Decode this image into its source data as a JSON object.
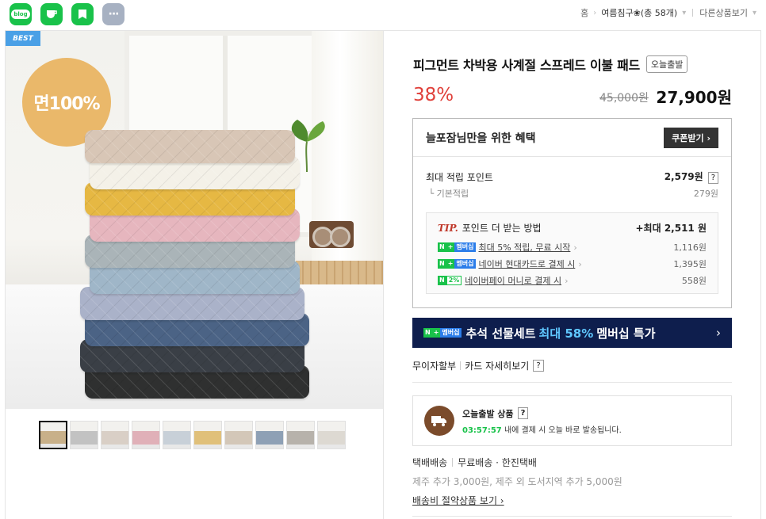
{
  "share": {
    "items": [
      {
        "name": "blog",
        "label": "blog"
      },
      {
        "name": "cafe",
        "label": ""
      },
      {
        "name": "band",
        "label": ""
      },
      {
        "name": "more",
        "label": "···"
      }
    ]
  },
  "breadcrumb": {
    "home": "홈",
    "current": "여름침구❀(총 58개)",
    "other": "다른상품보기"
  },
  "gallery": {
    "best_badge": "BEST",
    "cotton_label": "면100%",
    "thumb_count": 10
  },
  "product": {
    "title": "피그먼트 차박용 사계절 스프레드 이불 패드",
    "tag": "오늘출발",
    "discount": "38%",
    "original_price": "45,000원",
    "sale_price": "27,900원"
  },
  "benefit": {
    "title": "늘포잠님만을 위한 혜택",
    "coupon_button": "쿠폰받기 ›",
    "max_points_label": "최대 적립 포인트",
    "max_points_value": "2,579원",
    "base_label": "기본적립",
    "base_value": "279원",
    "tip_prefix": "TIP.",
    "tip_title": "포인트 더 받는 방법",
    "tip_total": "+최대 2,511 원",
    "tips": [
      {
        "badge": "N+멤버십",
        "text": "최대 5% 적립, 무료 시작",
        "value": "1,116원"
      },
      {
        "badge": "N+멤버십",
        "text": "네이버 현대카드로 결제 시",
        "value": "1,395원"
      },
      {
        "badge": "N2%",
        "text": "네이버페이 머니로 결제 시",
        "value": "558원"
      }
    ]
  },
  "promo": {
    "pre": "추석 선물세트",
    "highlight": "최대 58%",
    "post": "멤버십 특가",
    "chevron": "›"
  },
  "payment": {
    "installment": "무이자할부",
    "card_info": "카드 자세히보기",
    "q": "?"
  },
  "shipping": {
    "title": "오늘출발 상품",
    "time": "03:57:57",
    "desc": "내에 결제 시 오늘 바로 발송됩니다.",
    "method": "택배배송",
    "fee": "무료배송 · 한진택배",
    "extra": "제주 추가 3,000원, 제주 외 도서지역 추가 5,000원",
    "save_link": "배송비 절약상품 보기 ›"
  },
  "colors": {
    "accent_red": "#e0403a",
    "naver_green": "#19c24a",
    "promo_bg": "#0e1e4d",
    "promo_highlight": "#5fc7ff"
  },
  "quilt_colors": [
    "#d8c6b6",
    "#f4f1e8",
    "#e6b843",
    "#e6b6be",
    "#aab4b8",
    "#9fb6c8",
    "#aab2c9",
    "#4b6385",
    "#3a3f46",
    "#2f3030"
  ],
  "thumb_colors": [
    "#c8b089",
    "#c2c2c2",
    "#d9cfc6",
    "#e0b0b8",
    "#c8d0d8",
    "#e0c07a",
    "#d3c7b8",
    "#8ea0b5",
    "#b7b2ab",
    "#ddd9d2"
  ]
}
